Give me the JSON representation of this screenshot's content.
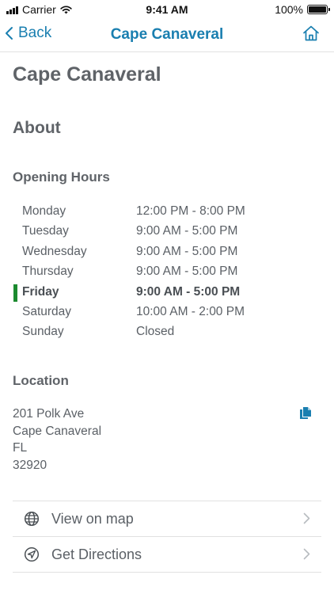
{
  "status_bar": {
    "carrier": "Carrier",
    "time": "9:41 AM",
    "battery": "100%",
    "battery_level": 1.0
  },
  "nav": {
    "back_label": "Back",
    "title": "Cape Canaveral"
  },
  "page": {
    "title": "Cape Canaveral",
    "about_heading": "About",
    "hours_heading": "Opening Hours",
    "location_heading": "Location"
  },
  "hours": [
    {
      "day": "Monday",
      "time": "12:00 PM - 8:00 PM",
      "current": false
    },
    {
      "day": "Tuesday",
      "time": "9:00 AM - 5:00 PM",
      "current": false
    },
    {
      "day": "Wednesday",
      "time": "9:00 AM - 5:00 PM",
      "current": false
    },
    {
      "day": "Thursday",
      "time": "9:00 AM - 5:00 PM",
      "current": false
    },
    {
      "day": "Friday",
      "time": "9:00 AM - 5:00 PM",
      "current": true
    },
    {
      "day": "Saturday",
      "time": "10:00 AM - 2:00 PM",
      "current": false
    },
    {
      "day": "Sunday",
      "time": "Closed",
      "current": false
    }
  ],
  "address": {
    "street": "201 Polk Ave",
    "city": "Cape Canaveral",
    "state": "FL",
    "zip": "32920"
  },
  "actions": [
    {
      "label": "View on map",
      "icon": "globe-icon"
    },
    {
      "label": "Get Directions",
      "icon": "navigation-arrow-icon"
    }
  ],
  "colors": {
    "accent": "#1a7fb0",
    "current_day_marker": "#1b8a2f",
    "text": "#5b6066"
  }
}
